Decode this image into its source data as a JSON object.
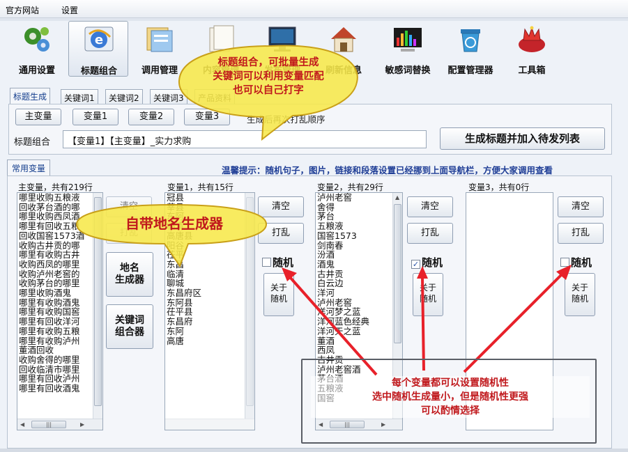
{
  "menu": [
    "官方网站",
    "设置"
  ],
  "toolbar": [
    {
      "label": "通用设置",
      "icon": "gears-icon",
      "color": "#3c8f2a"
    },
    {
      "label": "标题组合",
      "icon": "ie-browser-icon",
      "color": "#2f6fc9"
    },
    {
      "label": "调用管理",
      "icon": "folders-icon",
      "color": "#d9a84a"
    },
    {
      "label": "内容管理",
      "icon": "documents-icon",
      "color": "#b0a58c"
    },
    {
      "label": "发布管理",
      "icon": "monitor-icon",
      "color": "#2f5d8f"
    },
    {
      "label": "刷新信息",
      "icon": "house-icon",
      "color": "#b5472d"
    },
    {
      "label": "敏感词替换",
      "icon": "equalizer-icon",
      "color": "#333333"
    },
    {
      "label": "配置管理器",
      "icon": "recycle-bin-icon",
      "color": "#3a8fc4"
    },
    {
      "label": "工具箱",
      "icon": "crown-cushion-icon",
      "color": "#c4242a"
    }
  ],
  "tabs": [
    "标题生成",
    "关键词1",
    "关键词2",
    "关键词3",
    "产品资料"
  ],
  "vars_buttons": [
    "主变量",
    "变量1",
    "变量2",
    "变量3"
  ],
  "shuffle_hint": "生成后再次打乱顺序",
  "title_combo": {
    "label": "标题组合",
    "value": "【变量1】【主变量】_实力求购",
    "generate_button": "生成标题并加入待发列表"
  },
  "common_tab": "常用变量",
  "tip": "温馨提示：随机句子，图片，链接和段落设置已经挪到上面导航栏，方便大家调用查看",
  "lists": {
    "main": {
      "header": "主变量，共有219行",
      "items": [
        "哪里收购五粮液",
        "回收茅台酒的哪",
        "哪里收购西凤酒",
        "哪里有回收五粮",
        "回收国窖1573酒",
        "收购古井贡的哪",
        "哪里有收购古井",
        "收购西凤的哪里",
        "收购泸州老窖的",
        "收购茅台的哪里",
        "哪里收购酒鬼",
        "哪里有收购酒鬼",
        "哪里有收购国窖",
        "哪里有回收洋河",
        "哪里有收购五粮",
        "哪里有收购泸州",
        "董酒回收",
        "收购舍得的哪里",
        "回收临清市哪里",
        "哪里有回收泸州",
        "哪里有回收酒鬼"
      ]
    },
    "var1": {
      "header": "变量1，共有15行",
      "items": [
        "冠县",
        "莘县",
        "东阿",
        "临清",
        "高唐县",
        "阳谷",
        "茌平",
        "东昌",
        "临清",
        "聊城",
        "东昌府区",
        "东阿县",
        "茌平县",
        "东昌府",
        "东阿",
        "高唐"
      ]
    },
    "var2": {
      "header": "变量2，共有29行",
      "items": [
        "泸州老窖",
        "舍得",
        "茅台",
        "五粮液",
        "国窖1573",
        "剑南春",
        "汾酒",
        "酒鬼",
        "古井贡",
        "白云边",
        "洋河",
        "泸州老窖",
        "洋河梦之蓝",
        "洋河蓝色经典",
        "洋河天之蓝",
        "董酒",
        "西凤",
        "古井贡",
        "泸州老窖酒",
        "茅台酒",
        "五粮液",
        "国窖"
      ]
    },
    "var3": {
      "header": "变量3，共有0行",
      "items": []
    }
  },
  "column_controls": {
    "clear": "清空",
    "shuffle": "打乱",
    "random": "随机",
    "about_random": "关于\n随机",
    "random_checked": [
      false,
      true,
      false
    ]
  },
  "left_buttons": {
    "place_name": "地名\n生成器",
    "keyword_combo": "关键词\n组合器"
  },
  "callouts": {
    "top": "标题组合，可批量生成\n关键词可以利用变量匹配\n也可以自己打字",
    "left": "自带地名生成器",
    "bottom": "每个变量都可以设置随机性\n选中随机生成量小，但是随机性更强\n可以酌情选择"
  },
  "colors": {
    "callout_fill": "#f7e84a",
    "callout_text": "#c0181c",
    "arrow": "#e8212a",
    "tip_text": "#1f3e96"
  }
}
